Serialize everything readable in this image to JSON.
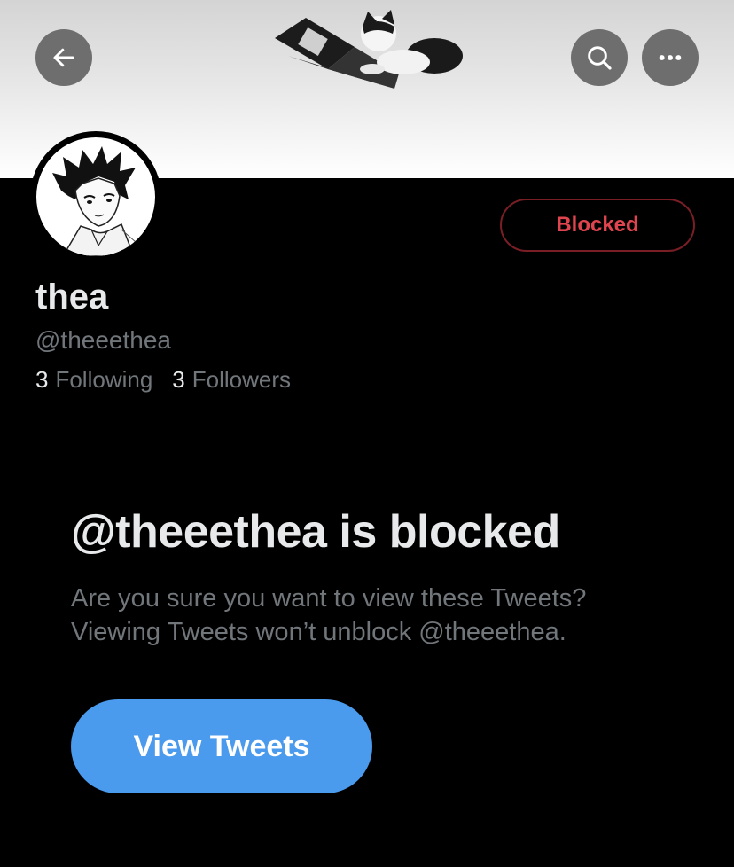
{
  "header": {
    "back_icon": "arrow-left-icon",
    "search_icon": "search-icon",
    "more_icon": "more-dots-icon"
  },
  "profile": {
    "name": "thea",
    "handle": "@theeethea",
    "following_count": "3",
    "following_label": "Following",
    "followers_count": "3",
    "followers_label": "Followers",
    "blocked_button_label": "Blocked"
  },
  "blocked_notice": {
    "title": "@theeethea is blocked",
    "description": "Are you sure you want to view these Tweets? Viewing Tweets won’t unblock @theeethea.",
    "view_button_label": "View Tweets"
  },
  "colors": {
    "background": "#000000",
    "blocked_red": "#e0454f",
    "accent_blue": "#4a9aed",
    "secondary_text": "#71767b"
  }
}
